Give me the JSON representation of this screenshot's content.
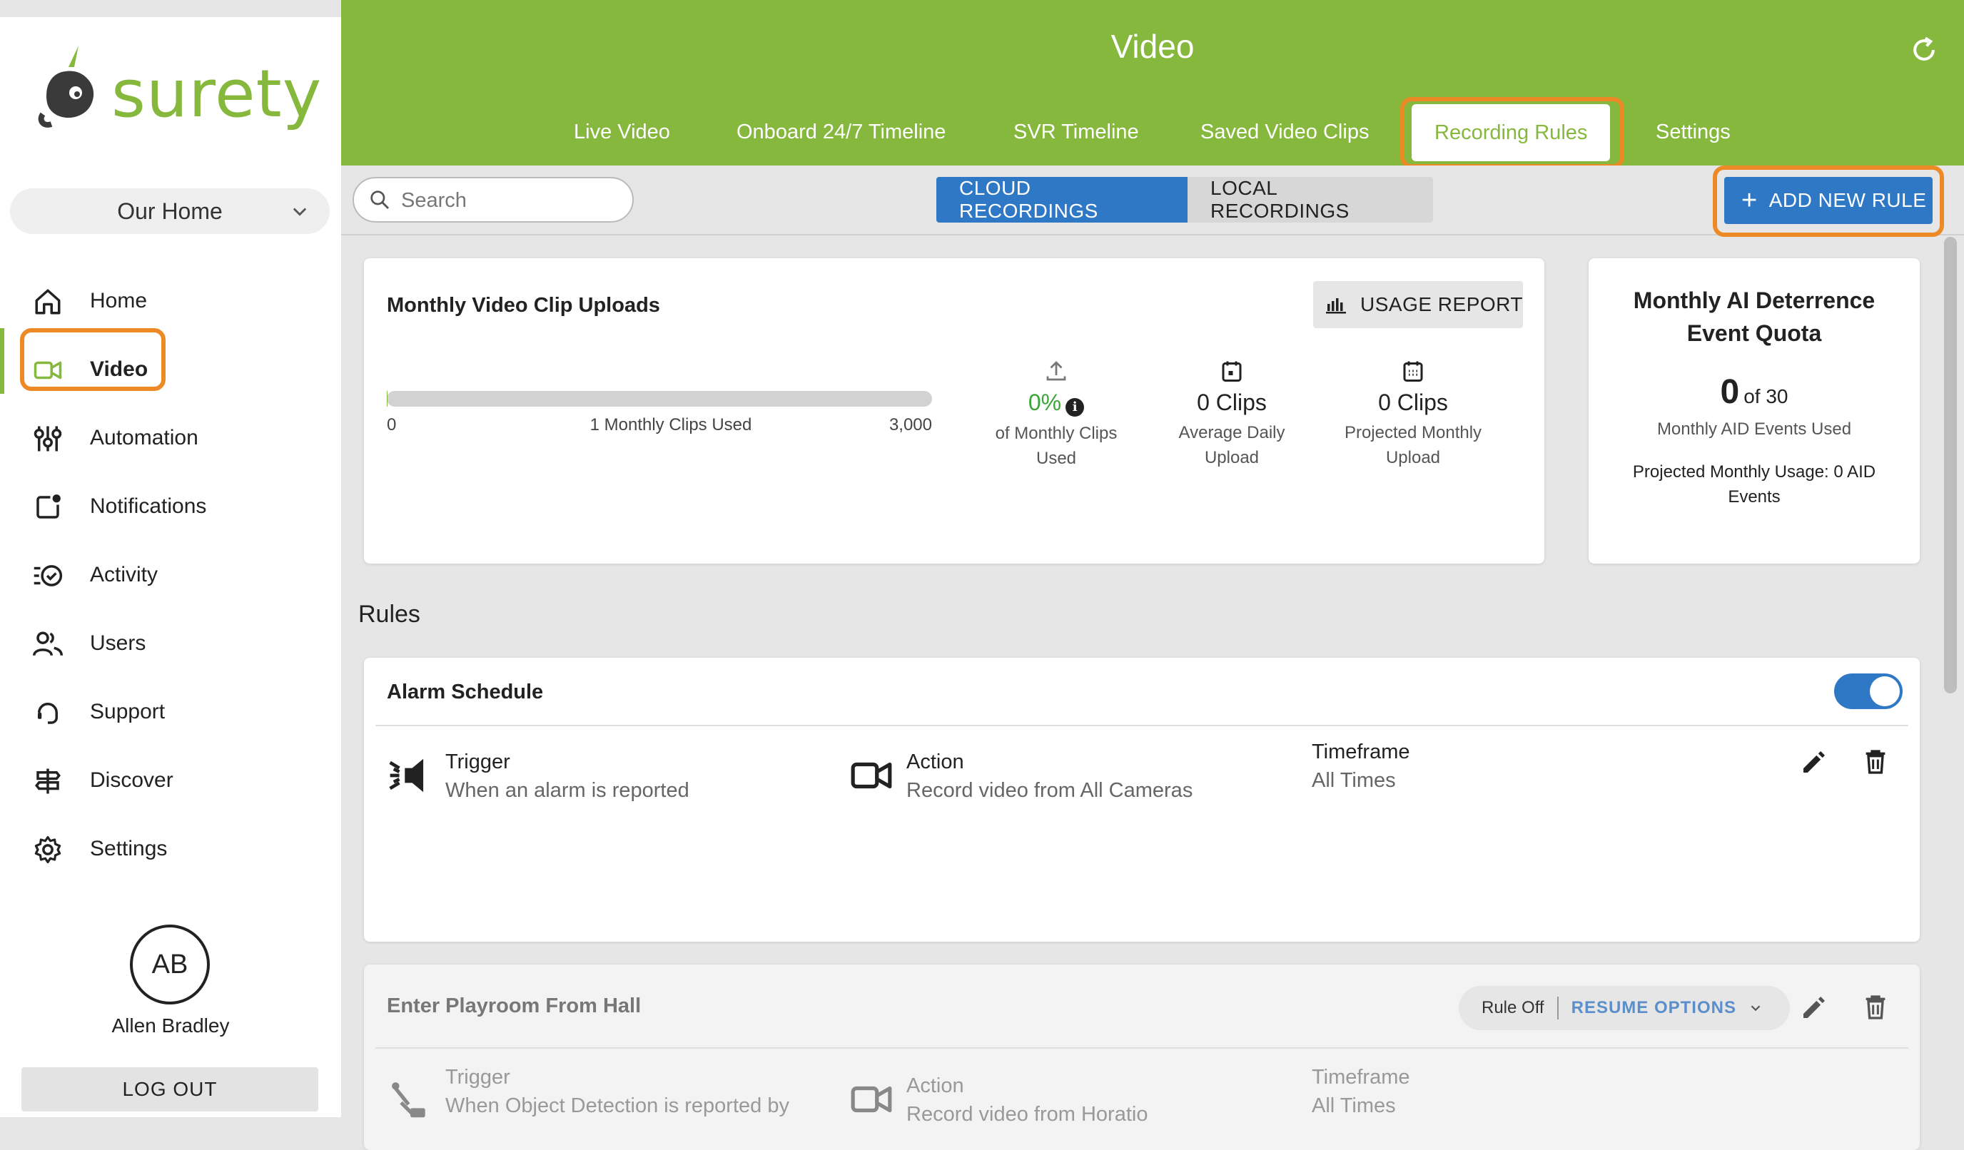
{
  "app": {
    "brand": "surety",
    "accent_color": "#86b83d",
    "primary_color": "#2f78c6",
    "highlight_color": "#ee8a25"
  },
  "sidebar": {
    "location": "Our Home",
    "items": [
      {
        "label": "Home",
        "icon": "home-icon"
      },
      {
        "label": "Video",
        "icon": "video-camera-icon",
        "active": true
      },
      {
        "label": "Automation",
        "icon": "sliders-icon"
      },
      {
        "label": "Notifications",
        "icon": "notification-icon"
      },
      {
        "label": "Activity",
        "icon": "activity-icon"
      },
      {
        "label": "Users",
        "icon": "users-icon"
      },
      {
        "label": "Support",
        "icon": "headset-icon"
      },
      {
        "label": "Discover",
        "icon": "signpost-icon"
      },
      {
        "label": "Settings",
        "icon": "gear-icon"
      }
    ],
    "user": {
      "initials": "AB",
      "name": "Allen Bradley"
    },
    "logout_label": "LOG OUT"
  },
  "header": {
    "title": "Video",
    "tabs": [
      {
        "label": "Live Video"
      },
      {
        "label": "Onboard 24/7 Timeline"
      },
      {
        "label": "SVR Timeline"
      },
      {
        "label": "Saved Video Clips"
      },
      {
        "label": "Recording Rules",
        "active": true
      },
      {
        "label": "Settings"
      }
    ]
  },
  "toolbar": {
    "search_placeholder": "Search",
    "segments": [
      "CLOUD RECORDINGS",
      "LOCAL RECORDINGS"
    ],
    "selected_segment": "CLOUD RECORDINGS",
    "add_rule_label": "ADD NEW RULE"
  },
  "uploads": {
    "title": "Monthly Video Clip Uploads",
    "usage_report_label": "USAGE REPORT",
    "progress": {
      "min": "0",
      "used_text": "1 Monthly Clips Used",
      "max": "3,000",
      "fraction": 0.0003
    },
    "stats": [
      {
        "value": "0%",
        "label": "of Monthly Clips Used",
        "icon": "upload-icon"
      },
      {
        "value": "0 Clips",
        "label": "Average Daily Upload",
        "icon": "calendar-day-icon"
      },
      {
        "value": "0 Clips",
        "label": "Projected Monthly Upload",
        "icon": "calendar-month-icon"
      }
    ]
  },
  "aid": {
    "title": "Monthly AI Deterrence Event Quota",
    "count": "0",
    "of_total": "of 30",
    "subtitle": "Monthly AID Events Used",
    "projected": "Projected Monthly Usage: 0 AID Events"
  },
  "rules": {
    "heading": "Rules",
    "items": [
      {
        "title": "Alarm Schedule",
        "enabled": true,
        "trigger": {
          "label": "Trigger",
          "value": "When an alarm is reported"
        },
        "action": {
          "label": "Action",
          "value": "Record video from All Cameras"
        },
        "timeframe": {
          "label": "Timeframe",
          "value": "All Times"
        }
      },
      {
        "title": "Enter Playroom From Hall",
        "enabled": false,
        "status_label": "Rule Off",
        "resume_label": "RESUME OPTIONS",
        "trigger": {
          "label": "Trigger",
          "value": "When Object Detection is reported by"
        },
        "action": {
          "label": "Action",
          "value": "Record video from Horatio"
        },
        "timeframe": {
          "label": "Timeframe",
          "value": "All Times"
        }
      }
    ]
  }
}
